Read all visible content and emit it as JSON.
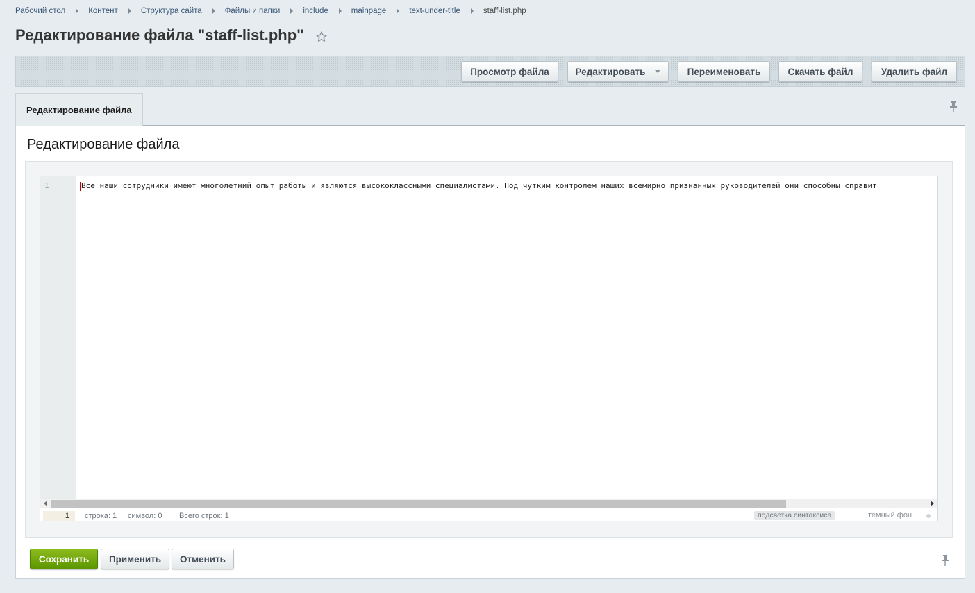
{
  "breadcrumb": {
    "items": [
      "Рабочий стол",
      "Контент",
      "Структура сайта",
      "Файлы и папки",
      "include",
      "mainpage",
      "text-under-title"
    ],
    "current": "staff-list.php"
  },
  "page": {
    "title": "Редактирование файла \"staff-list.php\""
  },
  "toolbar": {
    "view": "Просмотр файла",
    "edit": "Редактировать",
    "rename": "Переименовать",
    "download": "Скачать файл",
    "delete": "Удалить файл"
  },
  "tab": {
    "label": "Редактирование файла"
  },
  "section": {
    "title": "Редактирование файла"
  },
  "editor": {
    "line_number": "1",
    "code": "Все наши сотрудники имеют многолетний опыт работы и являются высококлассными специалистами. Под чутким контролем наших всемирно признанных руководителей они способны справит"
  },
  "status": {
    "current_line": "1",
    "row": "строка: 1",
    "symbol": "символ: 0",
    "total": "Всего строк: 1",
    "syntax": "подсветка синтаксиса",
    "dark": "темный фон"
  },
  "actions": {
    "save": "Сохранить",
    "apply": "Применить",
    "cancel": "Отменить"
  },
  "colors": {
    "save_button": "#6aa50b",
    "background": "#e6ecef",
    "cursor": "#cc0000"
  }
}
